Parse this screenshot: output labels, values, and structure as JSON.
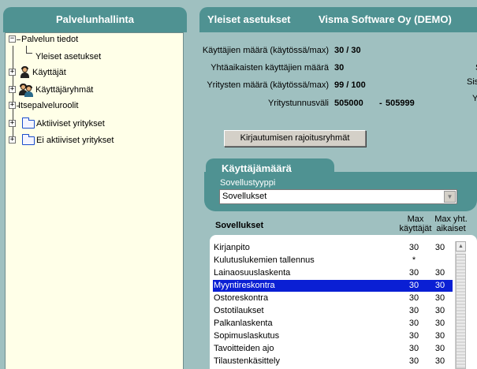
{
  "left": {
    "title": "Palvelunhallinta",
    "tree": [
      {
        "label": "Palvelun tiedot",
        "toggle": "−"
      },
      {
        "label": "Yleiset asetukset"
      },
      {
        "label": "Käyttäjät",
        "toggle": "+",
        "icon": "user-icon"
      },
      {
        "label": "Käyttäjäryhmät",
        "toggle": "+",
        "icon": "user-group-icon"
      },
      {
        "label": "Itsepalveluroolit",
        "toggle": "+"
      },
      {
        "label": "Aktiiviset yritykset",
        "toggle": "+",
        "icon": "folder-icon"
      },
      {
        "label": "Ei aktiiviset yritykset",
        "toggle": "+",
        "icon": "folder-icon"
      }
    ]
  },
  "right": {
    "title": "Yleiset asetukset",
    "company": "Visma Software Oy (DEMO)",
    "info": {
      "users_label": "Käyttäjien määrä (käytössä/max)",
      "users_value": "30 / 30",
      "concurrent_label": "Yhtäaikaisten käyttäjien määrä",
      "concurrent_value": "30",
      "companies_label": "Yritysten määrä (käytössä/max)",
      "companies_value": "99 / 100",
      "range_label": "Yritystunnusväli",
      "range_from": "505000",
      "range_sep": "-",
      "range_to": "505999"
    },
    "cutoff_labels": [
      "S",
      "Sis",
      "Y"
    ],
    "restrict_button": "Kirjautumisen rajoitusryhmät",
    "user_count": {
      "title": "Käyttäjämäärä",
      "type_label": "Sovellustyyppi",
      "type_value": "Sovellukset"
    },
    "apps": {
      "title": "Sovellukset",
      "col_max_users": "Max käyttäjät",
      "col_max_concurrent": "Max yht. aikaiset",
      "rows": [
        {
          "name": "Kirjanpito",
          "max": "30",
          "concurrent": "30"
        },
        {
          "name": "Kulutuslukemien tallennus",
          "max": "*",
          "concurrent": ""
        },
        {
          "name": "Lainaosuuslaskenta",
          "max": "30",
          "concurrent": "30"
        },
        {
          "name": "Myyntireskontra",
          "max": "30",
          "concurrent": "30",
          "selected": true
        },
        {
          "name": "Ostoreskontra",
          "max": "30",
          "concurrent": "30"
        },
        {
          "name": "Ostotilaukset",
          "max": "30",
          "concurrent": "30"
        },
        {
          "name": "Palkanlaskenta",
          "max": "30",
          "concurrent": "30"
        },
        {
          "name": "Sopimuslaskutus",
          "max": "30",
          "concurrent": "30"
        },
        {
          "name": "Tavoitteiden ajo",
          "max": "30",
          "concurrent": "30"
        },
        {
          "name": "Tilaustenkäsittely",
          "max": "30",
          "concurrent": "30"
        }
      ]
    }
  }
}
